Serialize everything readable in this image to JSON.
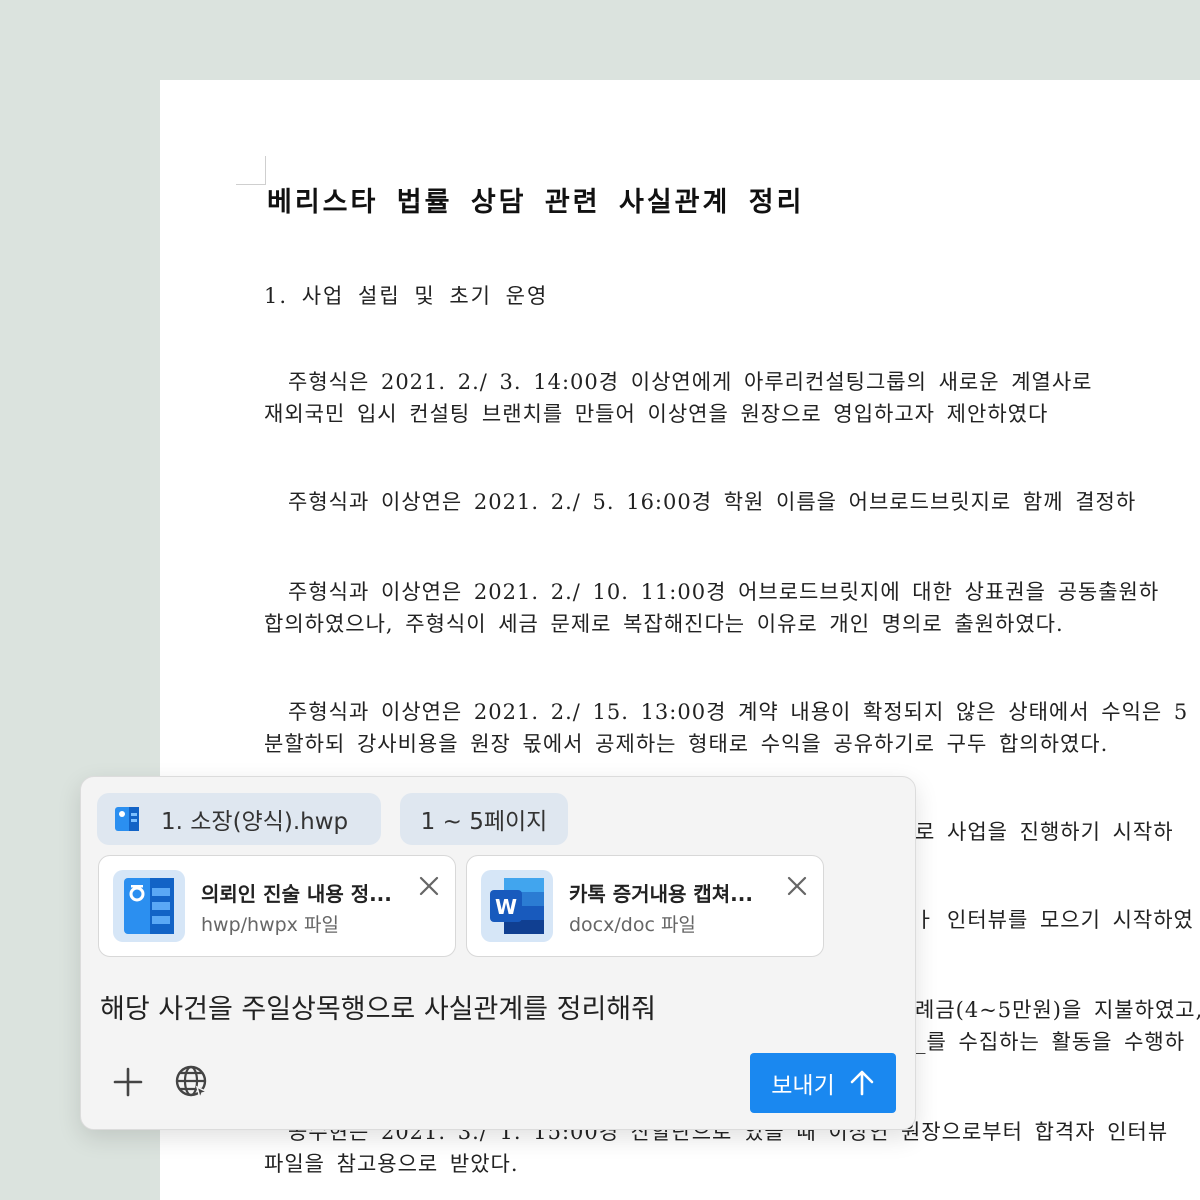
{
  "document": {
    "title": "베리스타 법률 상담 관련 사실관계 정리",
    "section_heading": "1. 사업 설립 및 초기 운영",
    "paragraphs": [
      [
        "주형식은 2021. 2./ 3. 14:00경 이상연에게 아루리컨설팅그룹의 새로운 계열사로",
        "재외국민 입시 컨설팅 브랜치를 만들어 이상연을 원장으로 영입하고자 제안하였다"
      ],
      [
        "주형식과 이상연은 2021. 2./ 5. 16:00경 학원 이름을 어브로드브릿지로 함께 결정하"
      ],
      [
        "주형식과 이상연은 2021. 2./ 10. 11:00경 어브로드브릿지에 대한 상표권을 공동출원하",
        "합의하였으나, 주형식이 세금 문제로 복잡해진다는 이유로 개인 명의로 출원하였다."
      ],
      [
        "주형식과 이상연은 2021. 2./ 15. 13:00경 계약 내용이 확정되지 않은 상태에서 수익은 5",
        "분할하되 강사비용을 원장 몫에서 공제하는 형태로 수익을 공유하기로 구두 합의하였다."
      ],
      [
        "로 사업을 진행하기 시작하"
      ],
      [
        "ㅏ 인터뷰를 모으기 시작하였"
      ],
      [
        "례금(4~5만원)을 지불하였고,",
        "_를 수집하는 활동을 수행하"
      ],
      [
        "공수현은 2021. 3./ 1. 15:00경 산할란으로 있을 때 이상연 원장으로부터 합격자 인터뷰",
        "파일을 참고용으로 받았다."
      ]
    ]
  },
  "composer": {
    "context_file_label": "1. 소장(양식).hwp",
    "page_range_label": "1 ~ 5페이지",
    "attachments": [
      {
        "name": "의뢰인 진술 내용 정...",
        "type": "hwp/hwpx 파일",
        "icon": "hwp-file-icon",
        "color": "#1a88f0"
      },
      {
        "name": "카톡 증거내용 캡쳐...",
        "type": "docx/doc 파일",
        "icon": "word-file-icon",
        "color": "#185abd"
      }
    ],
    "prompt": "해당 사건을 주일상목행으로 사실관계를 정리해줘",
    "send_label": "보내기",
    "accent_color": "#1a88f0"
  }
}
